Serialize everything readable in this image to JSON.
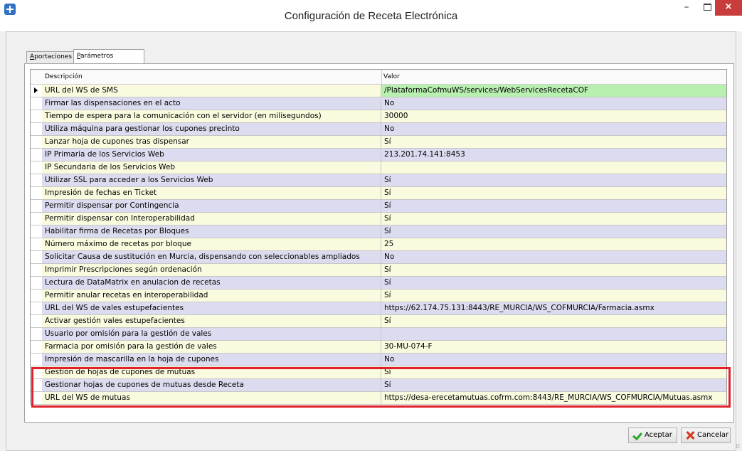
{
  "window": {
    "title": "Configuración de Receta Electrónica",
    "minimize": "–",
    "close": "×"
  },
  "tabs": [
    {
      "label": "Aportaciones",
      "mnemonic": "A",
      "rest": "portaciones"
    },
    {
      "label": "Parámetros",
      "mnemonic": "P",
      "rest": "arámetros",
      "active": true
    }
  ],
  "grid": {
    "columns": [
      "Descripción",
      "Valor"
    ],
    "rows": [
      {
        "desc": "URL del WS de SMS",
        "val": "/PlataformaCofmuWS/services/WebServicesRecetaCOF",
        "current": true
      },
      {
        "desc": "Firmar las dispensaciones en el acto",
        "val": "No"
      },
      {
        "desc": "Tiempo de espera para la comunicación con el servidor (en milisegundos)",
        "val": "30000"
      },
      {
        "desc": "Utiliza máquina para gestionar los cupones precinto",
        "val": "No"
      },
      {
        "desc": "Lanzar hoja de cupones tras dispensar",
        "val": "Sí"
      },
      {
        "desc": "IP Primaria de los Servicios Web",
        "val": "213.201.74.141:8453"
      },
      {
        "desc": "IP Secundaria de los Servicios Web",
        "val": ""
      },
      {
        "desc": "Utilizar SSL para acceder a los Servicios Web",
        "val": "Sí"
      },
      {
        "desc": "Impresión de fechas en Ticket",
        "val": "Sí"
      },
      {
        "desc": "Permitir dispensar por Contingencia",
        "val": "Sí"
      },
      {
        "desc": "Permitir dispensar con Interoperabilidad",
        "val": "Sí"
      },
      {
        "desc": "Habilitar firma de Recetas por Bloques",
        "val": "Sí"
      },
      {
        "desc": "Número máximo de recetas por bloque",
        "val": "25"
      },
      {
        "desc": "Solicitar Causa de sustitución en Murcia, dispensando con seleccionables ampliados",
        "val": "No"
      },
      {
        "desc": "Imprimir Prescripciones según ordenación",
        "val": "Sí"
      },
      {
        "desc": "Lectura de DataMatrix en anulacion de recetas",
        "val": "Sí"
      },
      {
        "desc": "Permitir anular recetas en interoperabilidad",
        "val": "Sí"
      },
      {
        "desc": "URL del WS de vales estupefacientes",
        "val": "https://62.174.75.131:8443/RE_MURCIA/WS_COFMURCIA/Farmacia.asmx"
      },
      {
        "desc": "Activar gestión vales estupefacientes",
        "val": "Sí"
      },
      {
        "desc": "Usuario por omisión para la gestión de vales",
        "val": ""
      },
      {
        "desc": "Farmacia por omisión para la gestión de vales",
        "val": "30-MU-074-F"
      },
      {
        "desc": "Impresión de mascarilla en la hoja de cupones",
        "val": "No"
      },
      {
        "desc": "Gestión de hojas de cupones de mutuas",
        "val": "Sí"
      },
      {
        "desc": "Gestionar hojas de cupones de mutuas desde Receta",
        "val": "Sí"
      },
      {
        "desc": "URL del WS de mutuas",
        "val": "https://desa-erecetamutuas.cofrm.com:8443/RE_MURCIA/WS_COFMURCIA/Mutuas.asmx"
      }
    ]
  },
  "footer": {
    "ok_label": "Aceptar",
    "cancel_label": "Cancelar"
  },
  "colors": {
    "row_odd": "#fafade",
    "row_even": "#dcdcf0",
    "current_value": "#b8f0b0",
    "highlight": "#e0202a",
    "close_button": "#c83c3c"
  },
  "icons": {
    "app": "app-cross-icon",
    "ok": "check-icon",
    "cancel": "x-icon"
  }
}
